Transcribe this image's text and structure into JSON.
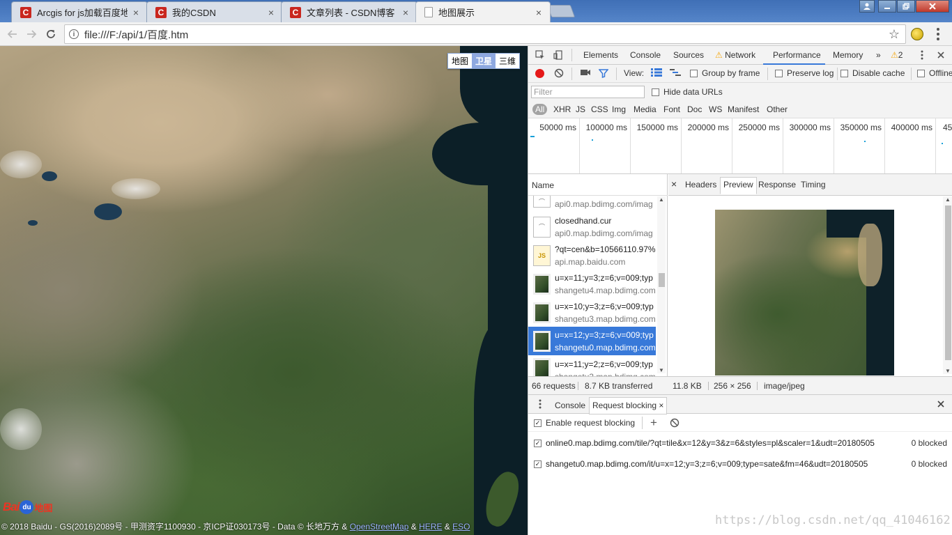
{
  "browser": {
    "tabs": [
      {
        "title": "Arcgis for js加载百度地",
        "favicon": "csdn-icon",
        "active": false
      },
      {
        "title": "我的CSDN",
        "favicon": "csdn-icon",
        "active": false
      },
      {
        "title": "文章列表 - CSDN博客",
        "favicon": "csdn-icon",
        "active": false
      },
      {
        "title": "地图展示",
        "favicon": "document-icon",
        "active": true
      }
    ],
    "tab_close_glyph": "×",
    "favicon_letter": "C",
    "url": "file:///F:/api/1/百度.htm"
  },
  "map": {
    "type_buttons": [
      "地图",
      "卫星",
      "三维"
    ],
    "selected_type": "卫星",
    "logo": {
      "bai": "Bai",
      "du": "du",
      "ditu": "地图"
    },
    "copyright_prefix": "© 2018 Baidu - GS(2016)2089号 - 甲测资字1100930 - 京ICP证030173号 - Data © 长地万方 & ",
    "copyright_links": [
      "OpenStreetMap",
      "HERE",
      "ESO"
    ],
    "copyright_amp": "&"
  },
  "devtools": {
    "main_tabs": [
      "Elements",
      "Console",
      "Sources",
      "Network",
      "Performance",
      "Memory"
    ],
    "active_tab": "Network",
    "more_tabs_glyph": "»",
    "warning_count": "2",
    "controls": {
      "view_label": "View:",
      "group_by_frame": "Group by frame",
      "preserve_log": "Preserve log",
      "disable_cache": "Disable cache",
      "offline": "Offline"
    },
    "filter_placeholder": "Filter",
    "hide_data_urls": "Hide data URLs",
    "type_filters": [
      "All",
      "XHR",
      "JS",
      "CSS",
      "Img",
      "Media",
      "Font",
      "Doc",
      "WS",
      "Manifest",
      "Other"
    ],
    "timeline_ticks": [
      "50000 ms",
      "100000 ms",
      "150000 ms",
      "200000 ms",
      "250000 ms",
      "300000 ms",
      "350000 ms",
      "400000 ms",
      "45"
    ],
    "name_header": "Name",
    "requests": [
      {
        "line1": "",
        "line2": "api0.map.bdimg.com/imag",
        "icon": "cursor-file-icon"
      },
      {
        "line1": "closedhand.cur",
        "line2": "api0.map.bdimg.com/imag",
        "icon": "cursor-file-icon"
      },
      {
        "line1": "?qt=cen&b=10566110.97%",
        "line2": "api.map.baidu.com",
        "icon": "js-file-icon"
      },
      {
        "line1": "u=x=11;y=3;z=6;v=009;typ",
        "line2": "shangetu4.map.bdimg.com",
        "icon": "image-thumbnail-icon"
      },
      {
        "line1": "u=x=10;y=3;z=6;v=009;typ",
        "line2": "shangetu3.map.bdimg.com",
        "icon": "image-thumbnail-icon"
      },
      {
        "line1": "u=x=12;y=3;z=6;v=009;typ",
        "line2": "shangetu0.map.bdimg.com",
        "icon": "image-thumbnail-icon",
        "selected": true
      },
      {
        "line1": "u=x=11;y=2;z=6;v=009;typ",
        "line2": "shangetu3.map.bdimg.com",
        "icon": "image-thumbnail-icon"
      }
    ],
    "js_badge": "JS",
    "cursor_badge": "⌒",
    "detail_tabs": [
      "Headers",
      "Preview",
      "Response",
      "Timing"
    ],
    "active_detail_tab": "Preview",
    "close_glyph": "×",
    "status": {
      "requests": "66 requests",
      "transferred": "8.7 KB transferred",
      "size": "11.8 KB",
      "dimensions": "256 × 256",
      "mime": "image/jpeg"
    },
    "drawer_tabs": [
      "Console",
      "Request blocking"
    ],
    "active_drawer_tab": "Request blocking",
    "enable_blocking": "Enable request blocking",
    "blocking_rules": [
      {
        "pattern": "online0.map.bdimg.com/tile/?qt=tile&x=12&y=3&z=6&styles=pl&scaler=1&udt=20180505",
        "count": "0 blocked",
        "checked": true
      },
      {
        "pattern": "shangetu0.map.bdimg.com/it/u=x=12;y=3;z=6;v=009;type=sate&fm=46&udt=20180505",
        "count": "0 blocked",
        "checked": true
      }
    ],
    "checkmark": "✓"
  },
  "watermark": "https://blog.csdn.net/qq_41046162"
}
